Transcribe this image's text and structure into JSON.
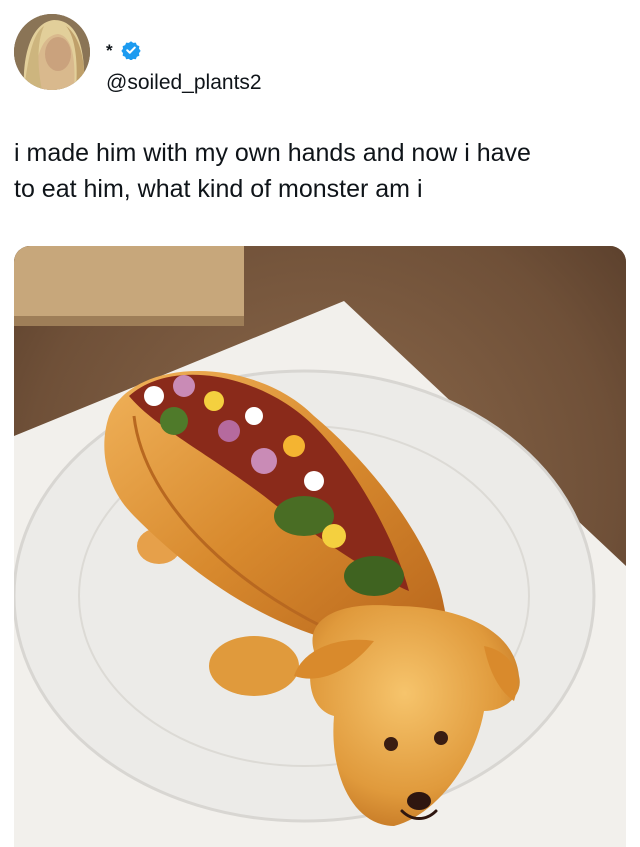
{
  "tweet": {
    "display_name": "*",
    "handle": "@soiled_plants2",
    "verified": true,
    "text": "i made him with my own hands and now i have\nto eat him, what kind of monster am i"
  },
  "icons": {
    "verified": "verified-badge-icon",
    "avatar": "avatar"
  },
  "colors": {
    "verified_blue": "#1d9bf0",
    "text": "#0f1419"
  }
}
